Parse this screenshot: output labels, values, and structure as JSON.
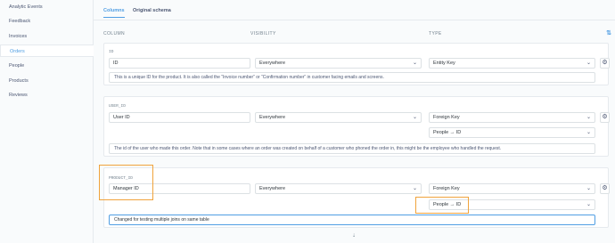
{
  "sidebar": {
    "items": [
      {
        "label": "Analytic Events"
      },
      {
        "label": "Feedback"
      },
      {
        "label": "Invoices"
      },
      {
        "label": "Orders"
      },
      {
        "label": "People"
      },
      {
        "label": "Products"
      },
      {
        "label": "Reviews"
      }
    ]
  },
  "tabs": [
    {
      "label": "Columns"
    },
    {
      "label": "Original schema"
    }
  ],
  "table_header": {
    "column": "COLUMN",
    "visibility": "VISIBILITY",
    "type": "TYPE",
    "sort_icon": "⇅"
  },
  "fields": [
    {
      "field_name": "ID",
      "display_name": "ID",
      "visibility": "Everywhere",
      "type": "Entity Key",
      "description": "This is a unique ID for the product. It is also called the “Invoice number” or “Confirmation number” in customer facing emails and screens."
    },
    {
      "field_name": "USER_ID",
      "display_name": "User ID",
      "visibility": "Everywhere",
      "type": "Foreign Key",
      "target": "People → ID",
      "description": "The id of the user who made this order. Note that in some cases where an order was created on behalf of a customer who phoned the order in, this might be the employee who handled the request."
    },
    {
      "field_name": "PRODUCT_ID",
      "display_name": "Manager ID",
      "visibility": "Everywhere",
      "type": "Foreign Key",
      "target": "People → ID",
      "description": "Changed for testing multiple joins on same table"
    }
  ],
  "bottom_marker": "⇣",
  "icons": {
    "chevron": "chevron-down-icon",
    "gear": "gear-icon"
  },
  "colors": {
    "accent": "#509ee3",
    "highlight": "#f0a33c"
  }
}
